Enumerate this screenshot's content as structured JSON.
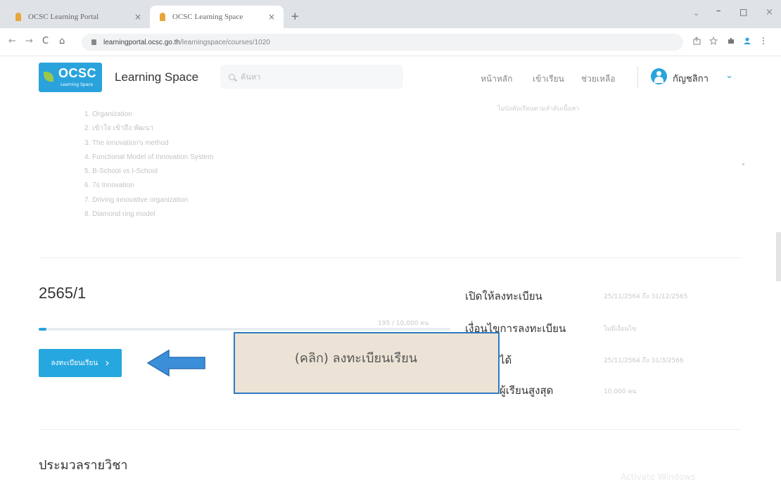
{
  "browser": {
    "tabs": [
      {
        "title": "OCSC Learning Portal",
        "close": "×"
      },
      {
        "title": "OCSC Learning Space",
        "close": "×"
      }
    ],
    "new_tab": "+",
    "window_controls": {
      "dropdown": "⌄",
      "minimize": "–",
      "maximize": "□",
      "close": "×"
    },
    "nav": {
      "back": "←",
      "forward": "→",
      "reload": "C",
      "home": "⌂"
    },
    "url_host": "learningportal.ocsc.go.th",
    "url_path": "/learningspace/courses/1020",
    "toolbar_icons": [
      "share-icon",
      "star-icon",
      "extensions-icon",
      "profile-icon",
      "menu-icon"
    ]
  },
  "header": {
    "logo_text": "OCSC",
    "logo_subtext": "Learning Space",
    "brand": "Learning Space",
    "search_placeholder": "ค้นหา",
    "nav": [
      "หน้าหลัก",
      "เข้าเรียน",
      "ช่วยเหลือ"
    ],
    "user_name": "กัญชลิกา",
    "accent_color": "#2aa3dd"
  },
  "course": {
    "note": "ไม่บังคับเรียนตามลำดับเนื้อหา",
    "topics": [
      "1. Organization",
      "2. เข้าใจ เข้าถึง พัฒนา",
      "3. The innovation's method",
      "4. Functional Model of Innovation System",
      "5. B-School vs I-School",
      "6. 7s Innovation",
      "7. Driving innovative organization",
      "8. Diamond ring model"
    ],
    "term": "2565/1",
    "enrolled": "195 / 10,000 คน",
    "progress_fraction": 0.0195,
    "enroll_button": "ลงทะเบียนเรียน",
    "enroll_arrow": "›",
    "meta": [
      {
        "label": "เปิดให้ลงทะเบียน",
        "value": "25/11/2564 ถึง 31/12/2565"
      },
      {
        "label": "เงื่อนไขการลงทะเบียน",
        "value": "ไม่มีเงื่อนไข"
      },
      {
        "label": "ได้",
        "value": "25/11/2564 ถึง 31/3/2566"
      },
      {
        "label": "ผู้เรียนสูงสุด",
        "value": "10,000 คน"
      }
    ],
    "section_title": "ประมวลรายวิชา"
  },
  "annotation": {
    "callout_text": "(คลิก) ลงทะเบียนเรียน",
    "arrow_color": "#3b8fd9"
  },
  "watermark": "Activate Windows"
}
